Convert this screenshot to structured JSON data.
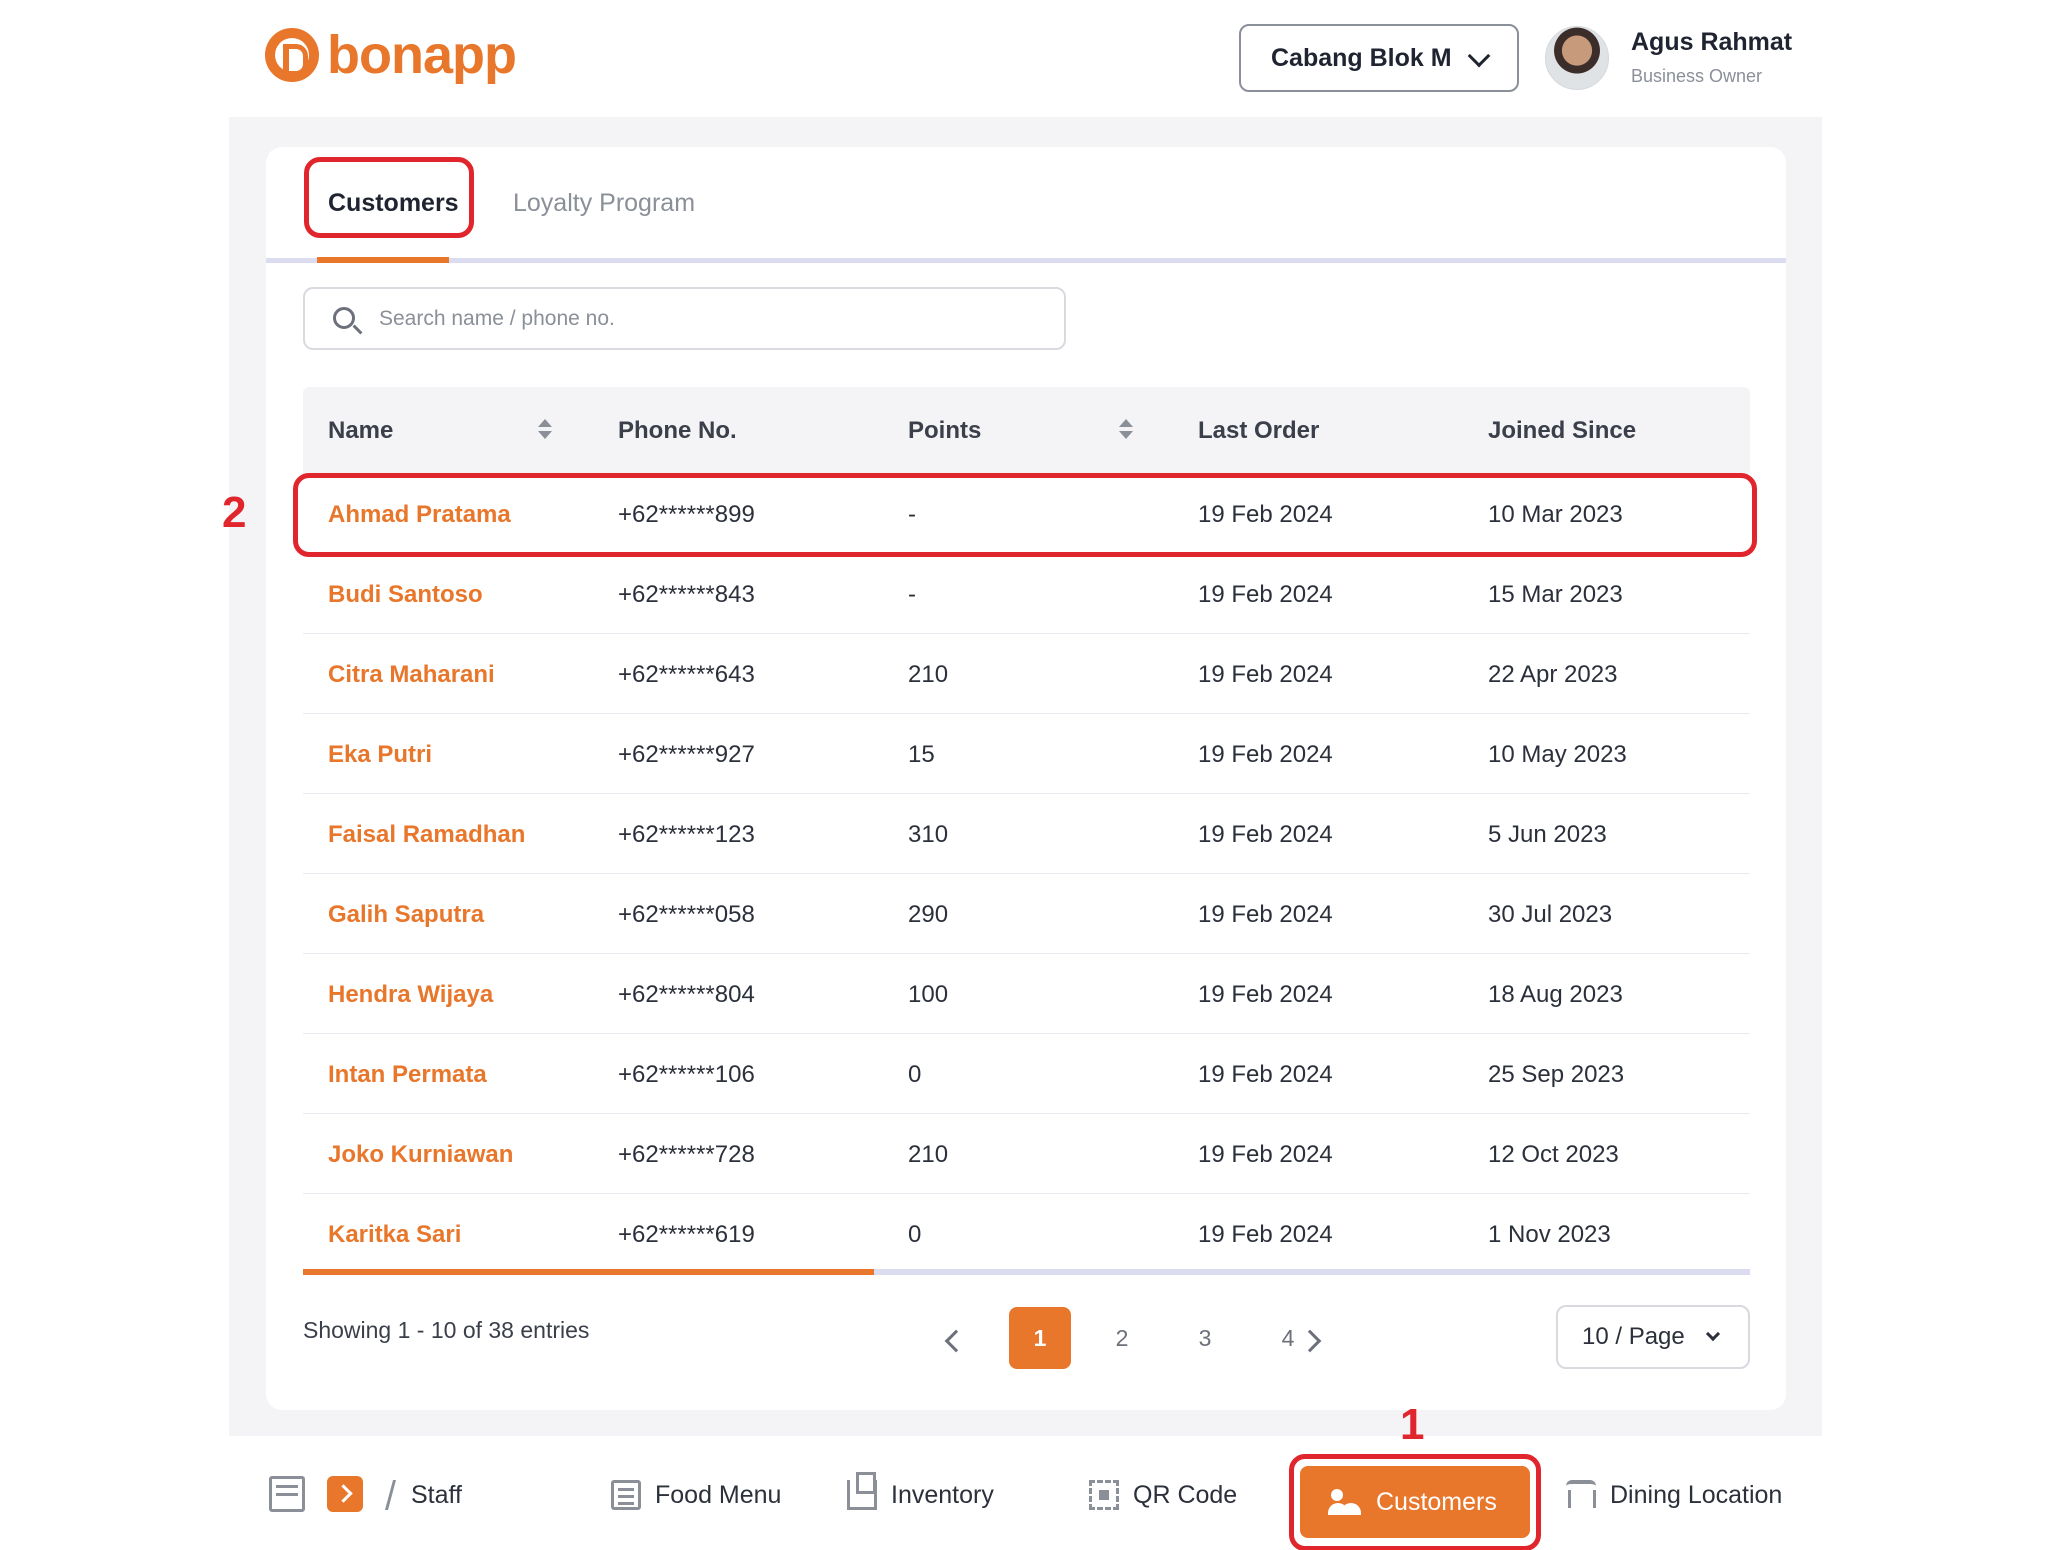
{
  "brand": {
    "name": "bonapp"
  },
  "header": {
    "branch": "Cabang Blok M",
    "user_name": "Agus Rahmat",
    "user_role": "Business Owner"
  },
  "tabs": [
    {
      "label": "Customers",
      "active": true
    },
    {
      "label": "Loyalty Program",
      "active": false
    }
  ],
  "search": {
    "placeholder": "Search name / phone no."
  },
  "table": {
    "columns": [
      "Name",
      "Phone No.",
      "Points",
      "Last Order",
      "Joined Since"
    ],
    "rows": [
      [
        "Ahmad Pratama",
        "+62******899",
        "-",
        "19 Feb 2024",
        "10 Mar 2023"
      ],
      [
        "Budi Santoso",
        "+62******843",
        "-",
        "19 Feb 2024",
        "15 Mar 2023"
      ],
      [
        "Citra Maharani",
        "+62******643",
        "210",
        "19 Feb 2024",
        "22 Apr 2023"
      ],
      [
        "Eka Putri",
        "+62******927",
        "15",
        "19 Feb 2024",
        "10 May 2023"
      ],
      [
        "Faisal Ramadhan",
        "+62******123",
        "310",
        "19 Feb 2024",
        "5 Jun 2023"
      ],
      [
        "Galih Saputra",
        "+62******058",
        "290",
        "19 Feb 2024",
        "30 Jul 2023"
      ],
      [
        "Hendra Wijaya",
        "+62******804",
        "100",
        "19 Feb 2024",
        "18 Aug 2023"
      ],
      [
        "Intan Permata",
        "+62******106",
        "0",
        "19 Feb 2024",
        "25 Sep 2023"
      ],
      [
        "Joko Kurniawan",
        "+62******728",
        "210",
        "19 Feb 2024",
        "12 Oct 2023"
      ],
      [
        "Karitka Sari",
        "+62******619",
        "0",
        "19 Feb 2024",
        "1 Nov 2023"
      ]
    ]
  },
  "pagination": {
    "showing": "Showing 1 - 10 of 38 entries",
    "pages": [
      "1",
      "2",
      "3",
      "4"
    ],
    "current": "1",
    "per_page": "10 / Page"
  },
  "nav": {
    "staff": "Staff",
    "food_menu": "Food Menu",
    "inventory": "Inventory",
    "qr_code": "QR Code",
    "customers": "Customers",
    "dining_location": "Dining Location"
  },
  "annotations": {
    "marker_1": "1",
    "marker_2": "2"
  },
  "colors": {
    "accent": "#e8762b",
    "highlight": "#e0262c",
    "text": "#1f2430",
    "muted": "#8a8f98"
  },
  "icons": [
    "logo-mark-icon",
    "chevron-down-icon",
    "search-icon",
    "sort-icon",
    "chevron-left-icon",
    "chevron-right-icon",
    "store-icon",
    "arrow-right-icon",
    "staff-icon",
    "food-menu-icon",
    "inventory-icon",
    "qr-code-icon",
    "customers-icon",
    "dining-location-icon"
  ]
}
